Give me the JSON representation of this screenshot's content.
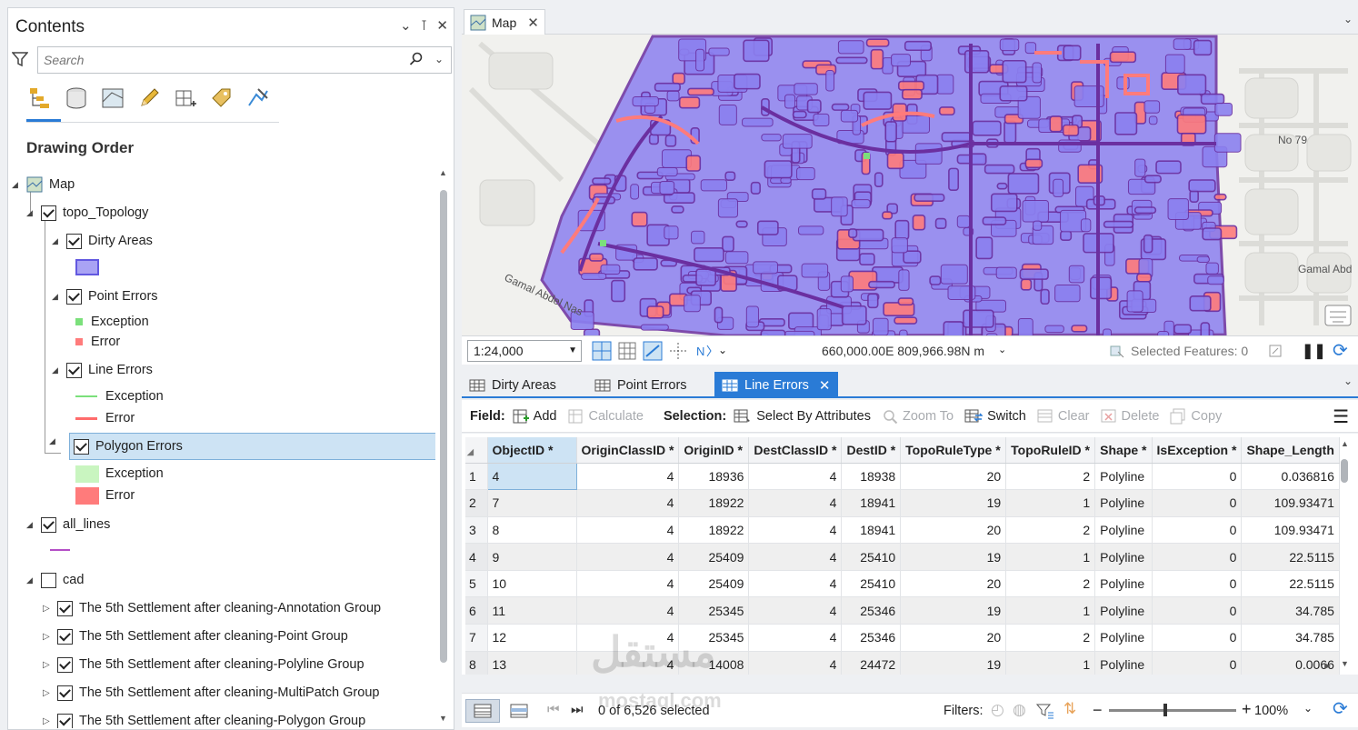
{
  "contents": {
    "title": "Contents",
    "search_placeholder": "Search",
    "heading": "Drawing Order",
    "tree": {
      "map": "Map",
      "topology": "topo_Topology",
      "dirty_areas": "Dirty Areas",
      "point_errors": "Point Errors",
      "point_exception": "Exception",
      "point_error": "Error",
      "line_errors": "Line Errors",
      "line_exception": "Exception",
      "line_error": "Error",
      "polygon_errors": "Polygon Errors",
      "polygon_exception": "Exception",
      "polygon_error": "Error",
      "all_lines": "all_lines",
      "cad": "cad",
      "cad_groups": [
        "The 5th Settlement after cleaning-Annotation Group",
        "The 5th Settlement after cleaning-Point Group",
        "The 5th Settlement after cleaning-Polyline Group",
        "The 5th Settlement after cleaning-MultiPatch Group",
        "The 5th Settlement after cleaning-Polygon Group"
      ]
    }
  },
  "map": {
    "tab_label": "Map",
    "labels": {
      "no79": "No 79",
      "gamal_abdel_nasser": "Gamal Abdel Nas",
      "gamal_abd": "Gamal Abd"
    },
    "scale": "1:24,000",
    "coordinates": "660,000.00E 809,966.98N m",
    "selected_features": "Selected Features: 0"
  },
  "table": {
    "tabs": [
      "Dirty Areas",
      "Point Errors",
      "Line Errors"
    ],
    "toolbar": {
      "field_label": "Field:",
      "add": "Add",
      "calculate": "Calculate",
      "selection_label": "Selection:",
      "select_by_attributes": "Select By Attributes",
      "zoom_to": "Zoom To",
      "switch": "Switch",
      "clear": "Clear",
      "delete": "Delete",
      "copy": "Copy"
    },
    "columns": [
      "ObjectID *",
      "OriginClassID *",
      "OriginID *",
      "DestClassID *",
      "DestID *",
      "TopoRuleType *",
      "TopoRuleID *",
      "Shape *",
      "IsException *",
      "Shape_Length"
    ],
    "rows": [
      [
        "1",
        "4",
        "4",
        "18936",
        "4",
        "18938",
        "20",
        "2",
        "Polyline",
        "0",
        "0.036816"
      ],
      [
        "2",
        "7",
        "4",
        "18922",
        "4",
        "18941",
        "19",
        "1",
        "Polyline",
        "0",
        "109.93471"
      ],
      [
        "3",
        "8",
        "4",
        "18922",
        "4",
        "18941",
        "20",
        "2",
        "Polyline",
        "0",
        "109.93471"
      ],
      [
        "4",
        "9",
        "4",
        "25409",
        "4",
        "25410",
        "19",
        "1",
        "Polyline",
        "0",
        "22.5115"
      ],
      [
        "5",
        "10",
        "4",
        "25409",
        "4",
        "25410",
        "20",
        "2",
        "Polyline",
        "0",
        "22.5115"
      ],
      [
        "6",
        "11",
        "4",
        "25345",
        "4",
        "25346",
        "19",
        "1",
        "Polyline",
        "0",
        "34.785"
      ],
      [
        "7",
        "12",
        "4",
        "25345",
        "4",
        "25346",
        "20",
        "2",
        "Polyline",
        "0",
        "34.785"
      ],
      [
        "8",
        "13",
        "4",
        "14008",
        "4",
        "24472",
        "19",
        "1",
        "Polyline",
        "0",
        "0.0066"
      ]
    ],
    "selection_count": "0 of 6,526 selected",
    "filters_label": "Filters:",
    "zoom_pct": "100%"
  },
  "watermark": {
    "arabic": "مستقل",
    "latin": "mostaql.com"
  },
  "colors": {
    "accent": "#2a7bd6",
    "line_feature": "#6b2fa0",
    "polygon_fill": "#8b80f0",
    "error": "#ff7b7b",
    "exception": "#7be07b"
  }
}
